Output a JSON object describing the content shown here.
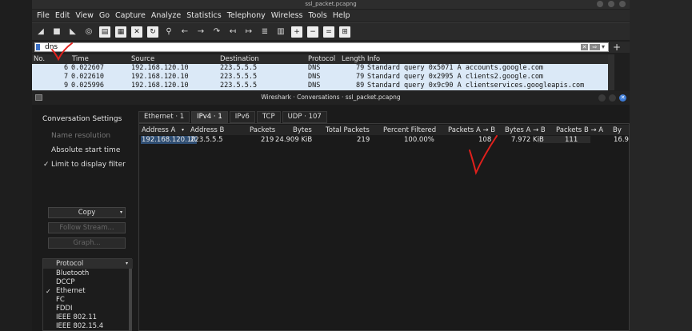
{
  "window": {
    "title": "ssl_packet.pcapng"
  },
  "menu": [
    "File",
    "Edit",
    "View",
    "Go",
    "Capture",
    "Analyze",
    "Statistics",
    "Telephony",
    "Wireless",
    "Tools",
    "Help"
  ],
  "filter": {
    "value": "dns"
  },
  "packet_list": {
    "columns": [
      "No.",
      "Time",
      "Source",
      "Destination",
      "Protocol",
      "Length",
      "Info"
    ],
    "rows": [
      {
        "no": "6",
        "time": "0.022607",
        "src": "192.168.120.10",
        "dst": "223.5.5.5",
        "proto": "DNS",
        "len": "79",
        "info": "Standard query 0x5071 A accounts.google.com"
      },
      {
        "no": "7",
        "time": "0.022610",
        "src": "192.168.120.10",
        "dst": "223.5.5.5",
        "proto": "DNS",
        "len": "79",
        "info": "Standard query 0x2995 A clients2.google.com"
      },
      {
        "no": "9",
        "time": "0.025996",
        "src": "192.168.120.10",
        "dst": "223.5.5.5",
        "proto": "DNS",
        "len": "89",
        "info": "Standard query 0x9c90 A clientservices.googleapis.com"
      }
    ]
  },
  "dialog": {
    "title": "Wireshark · Conversations · ssl_packet.pcapng",
    "settings_heading": "Conversation Settings",
    "options": {
      "name_resolution": "Name resolution",
      "absolute_start_time": "Absolute start time",
      "limit_to_display_filter": "Limit to display filter"
    },
    "buttons": {
      "copy": "Copy",
      "follow_stream": "Follow Stream...",
      "graph": "Graph..."
    },
    "protocol_list": {
      "header": "Protocol",
      "items": [
        {
          "name": "Bluetooth",
          "checked": false
        },
        {
          "name": "DCCP",
          "checked": false
        },
        {
          "name": "Ethernet",
          "checked": true
        },
        {
          "name": "FC",
          "checked": false
        },
        {
          "name": "FDDI",
          "checked": false
        },
        {
          "name": "IEEE 802.11",
          "checked": false
        },
        {
          "name": "IEEE 802.15.4",
          "checked": false
        }
      ]
    },
    "tabs": [
      "Ethernet · 1",
      "IPv4 · 1",
      "IPv6",
      "TCP",
      "UDP · 107"
    ],
    "active_tab": "IPv4 · 1",
    "table": {
      "columns": [
        "Address A",
        "Address B",
        "Packets",
        "Bytes",
        "Total Packets",
        "Percent Filtered",
        "Packets A → B",
        "Bytes A → B",
        "Packets B → A",
        "By"
      ],
      "rows": [
        {
          "addr_a": "192.168.120.10",
          "addr_b": "223.5.5.5",
          "packets": "219",
          "bytes": "24.909 KiB",
          "total_packets": "219",
          "percent_filtered": "100.00%",
          "packets_ab": "108",
          "bytes_ab": "7.972 KiB",
          "packets_ba": "111",
          "bytes_ba": "16.9"
        }
      ]
    }
  },
  "colors": {
    "annotation": "#e0201c",
    "selection": "#dbe9f7",
    "accent": "#3d7bd6"
  }
}
